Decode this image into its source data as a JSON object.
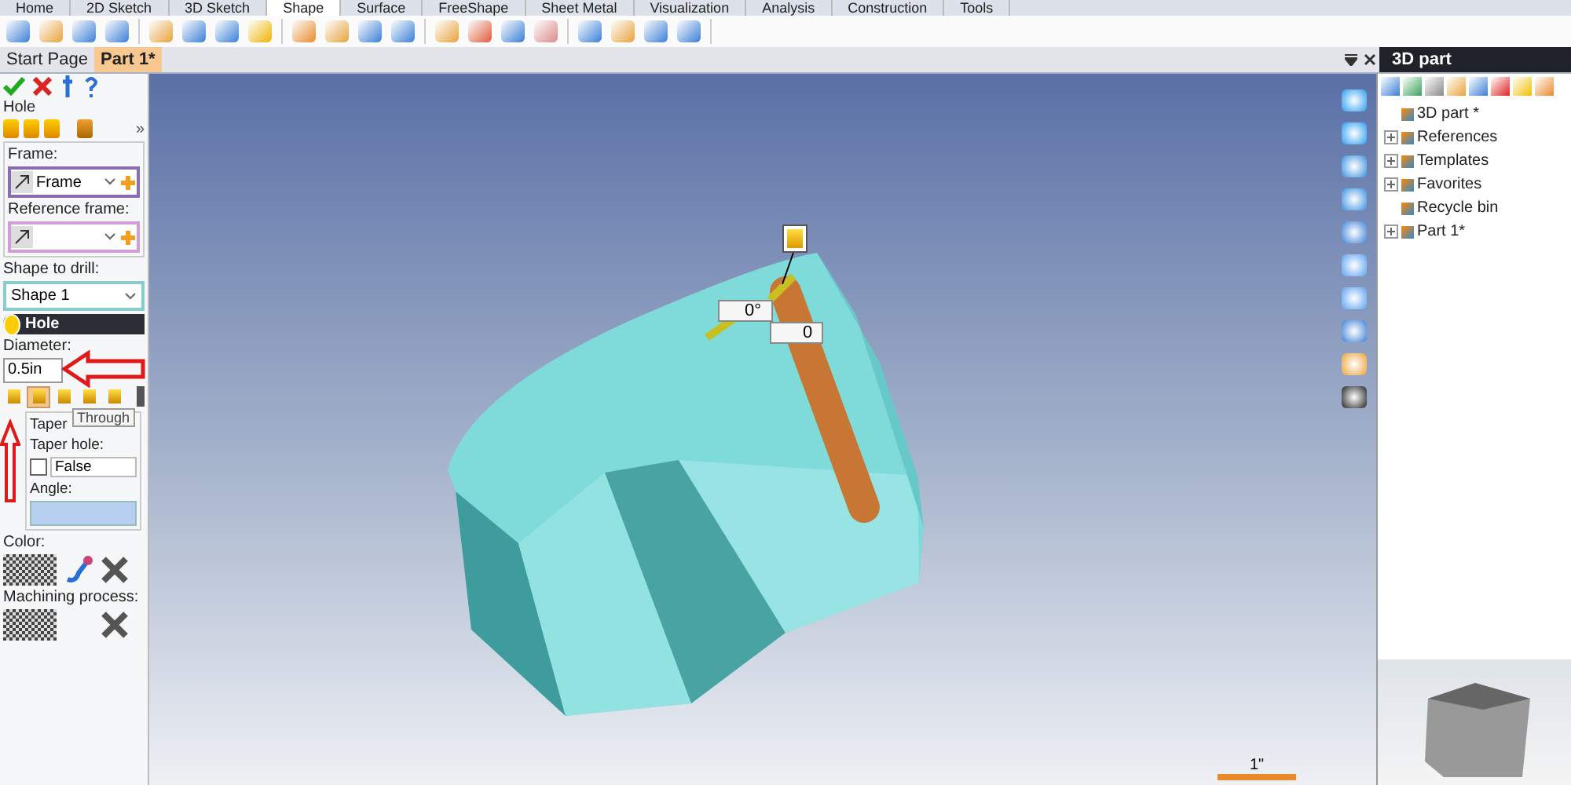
{
  "ribbon_tabs": [
    {
      "label": "Home",
      "selected": false
    },
    {
      "label": "2D Sketch",
      "selected": false
    },
    {
      "label": "3D Sketch",
      "selected": false
    },
    {
      "label": "Shape",
      "selected": true
    },
    {
      "label": "Surface",
      "selected": false
    },
    {
      "label": "FreeShape",
      "selected": false
    },
    {
      "label": "Sheet Metal",
      "selected": false
    },
    {
      "label": "Visualization",
      "selected": false
    },
    {
      "label": "Analysis",
      "selected": false
    },
    {
      "label": "Construction",
      "selected": false
    },
    {
      "label": "Tools",
      "selected": false
    }
  ],
  "doc_tabs": [
    {
      "label": "Start Page",
      "selected": false
    },
    {
      "label": "Part 1*",
      "selected": true
    }
  ],
  "left_panel": {
    "title": "Hole",
    "more": "»",
    "frame_label": "Frame:",
    "frame_value": "Frame",
    "reference_frame_label": "Reference frame:",
    "shape_label": "Shape to drill:",
    "shape_value": "Shape 1",
    "section_title": "Hole",
    "diameter_label": "Diameter:",
    "diameter_value": "0.5in",
    "hole_types": [
      {
        "selected": false
      },
      {
        "selected": true
      },
      {
        "selected": false
      },
      {
        "selected": false
      },
      {
        "selected": false
      }
    ],
    "tooltip": "Through",
    "taper_group": "Taper",
    "taper_hole_label": "Taper hole:",
    "taper_checked": false,
    "taper_value": "False",
    "angle_label": "Angle:",
    "color_label": "Color:",
    "machining_label": "Machining process:"
  },
  "viewport": {
    "angle_value": "0°",
    "offset_value": "0",
    "scale_label": "1\""
  },
  "tree_panel": {
    "title": "3D part",
    "items": [
      {
        "label": "3D part *",
        "expandable": false
      },
      {
        "label": "References",
        "expandable": true
      },
      {
        "label": "Templates",
        "expandable": true
      },
      {
        "label": "Favorites",
        "expandable": true
      },
      {
        "label": "Recycle bin",
        "expandable": false
      },
      {
        "label": "Part 1*",
        "expandable": true
      }
    ]
  }
}
